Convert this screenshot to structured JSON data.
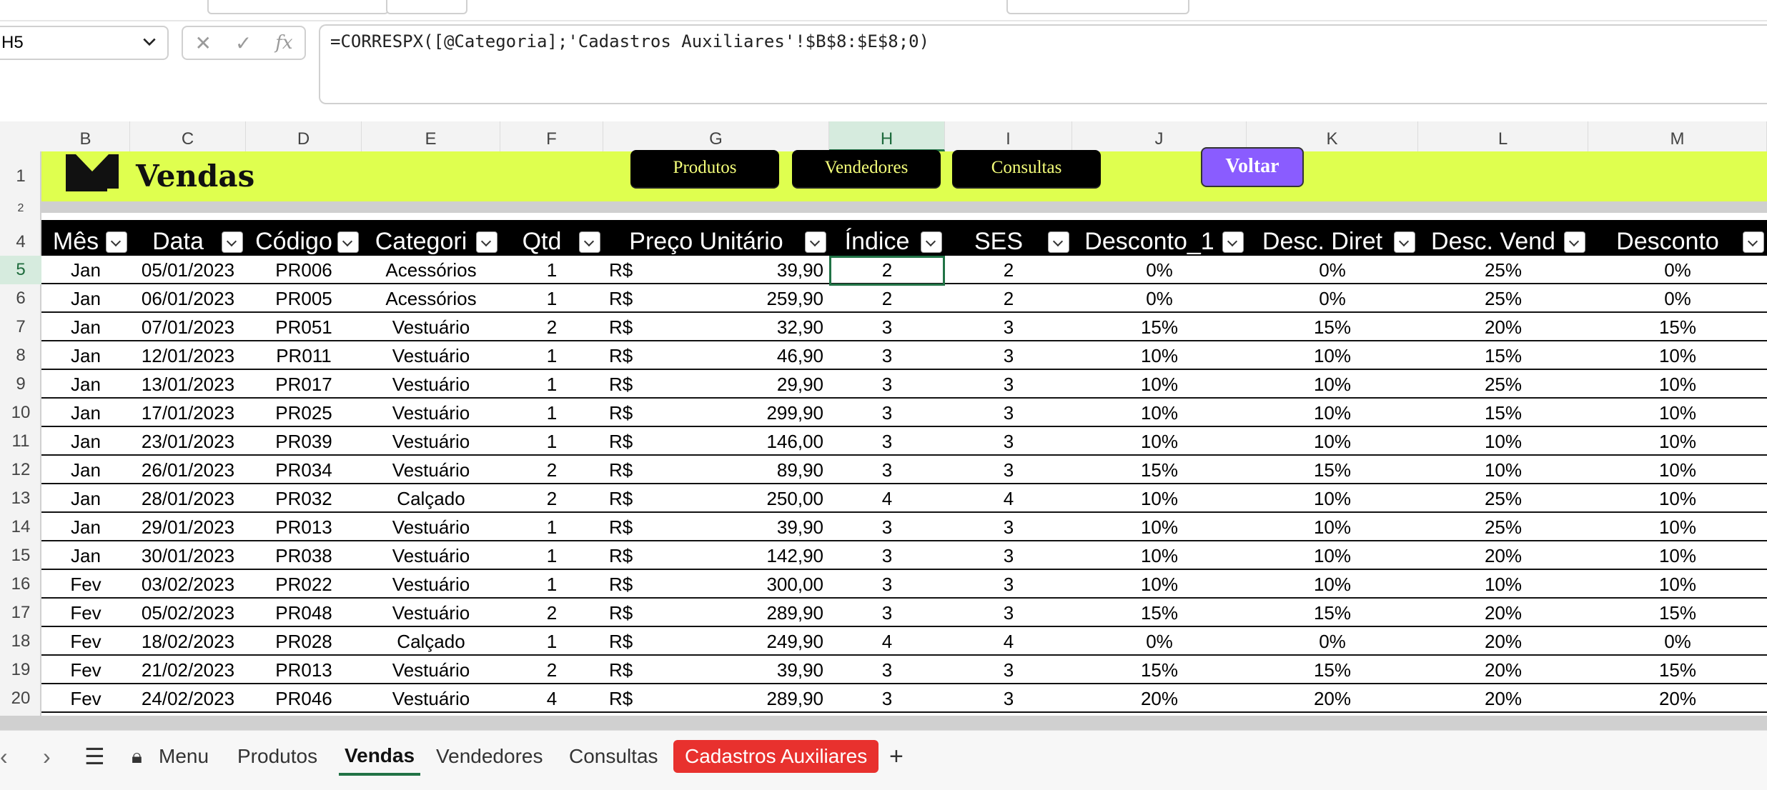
{
  "formula_bar": {
    "name_box": "H5",
    "formula": "=CORRESPX([@Categoria];'Cadastros Auxiliares'!$B$8:$E$8;0)",
    "fx_label": "fx"
  },
  "column_headers": [
    "B",
    "C",
    "D",
    "E",
    "F",
    "G",
    "H",
    "I",
    "J",
    "K",
    "L",
    "M"
  ],
  "selected_column": "H",
  "row_headers": [
    "1",
    "2",
    "4",
    "5",
    "6",
    "7",
    "8",
    "9",
    "10",
    "11",
    "12",
    "13",
    "14",
    "15",
    "16",
    "17",
    "18",
    "19",
    "20"
  ],
  "selected_row": "5",
  "banner": {
    "title": "Vendas",
    "buttons": [
      "Produtos",
      "Vendedores",
      "Consultas"
    ],
    "back_button": "Voltar"
  },
  "table": {
    "headers": [
      "Mês",
      "Data",
      "Código",
      "Categori",
      "Qtd",
      "Preço Unitário",
      "Índice",
      "SES",
      "Desconto_1",
      "Desc. Diret",
      "Desc. Vend",
      "Desconto"
    ],
    "currency_symbol": "R$",
    "rows": [
      [
        "Jan",
        "05/01/2023",
        "PR006",
        "Acessórios",
        "1",
        "39,90",
        "2",
        "2",
        "0%",
        "0%",
        "25%",
        "0%"
      ],
      [
        "Jan",
        "06/01/2023",
        "PR005",
        "Acessórios",
        "1",
        "259,90",
        "2",
        "2",
        "0%",
        "0%",
        "25%",
        "0%"
      ],
      [
        "Jan",
        "07/01/2023",
        "PR051",
        "Vestuário",
        "2",
        "32,90",
        "3",
        "3",
        "15%",
        "15%",
        "20%",
        "15%"
      ],
      [
        "Jan",
        "12/01/2023",
        "PR011",
        "Vestuário",
        "1",
        "46,90",
        "3",
        "3",
        "10%",
        "10%",
        "15%",
        "10%"
      ],
      [
        "Jan",
        "13/01/2023",
        "PR017",
        "Vestuário",
        "1",
        "29,90",
        "3",
        "3",
        "10%",
        "10%",
        "25%",
        "10%"
      ],
      [
        "Jan",
        "17/01/2023",
        "PR025",
        "Vestuário",
        "1",
        "299,90",
        "3",
        "3",
        "10%",
        "10%",
        "15%",
        "10%"
      ],
      [
        "Jan",
        "23/01/2023",
        "PR039",
        "Vestuário",
        "1",
        "146,00",
        "3",
        "3",
        "10%",
        "10%",
        "10%",
        "10%"
      ],
      [
        "Jan",
        "26/01/2023",
        "PR034",
        "Vestuário",
        "2",
        "89,90",
        "3",
        "3",
        "15%",
        "15%",
        "10%",
        "10%"
      ],
      [
        "Jan",
        "28/01/2023",
        "PR032",
        "Calçado",
        "2",
        "250,00",
        "4",
        "4",
        "10%",
        "10%",
        "25%",
        "10%"
      ],
      [
        "Jan",
        "29/01/2023",
        "PR013",
        "Vestuário",
        "1",
        "39,90",
        "3",
        "3",
        "10%",
        "10%",
        "25%",
        "10%"
      ],
      [
        "Jan",
        "30/01/2023",
        "PR038",
        "Vestuário",
        "1",
        "142,90",
        "3",
        "3",
        "10%",
        "10%",
        "20%",
        "10%"
      ],
      [
        "Fev",
        "03/02/2023",
        "PR022",
        "Vestuário",
        "1",
        "300,00",
        "3",
        "3",
        "10%",
        "10%",
        "10%",
        "10%"
      ],
      [
        "Fev",
        "05/02/2023",
        "PR048",
        "Vestuário",
        "2",
        "289,90",
        "3",
        "3",
        "15%",
        "15%",
        "20%",
        "15%"
      ],
      [
        "Fev",
        "18/02/2023",
        "PR028",
        "Calçado",
        "1",
        "249,90",
        "4",
        "4",
        "0%",
        "0%",
        "20%",
        "0%"
      ],
      [
        "Fev",
        "21/02/2023",
        "PR013",
        "Vestuário",
        "2",
        "39,90",
        "3",
        "3",
        "15%",
        "15%",
        "20%",
        "15%"
      ],
      [
        "Fev",
        "24/02/2023",
        "PR046",
        "Vestuário",
        "4",
        "289,90",
        "3",
        "3",
        "20%",
        "20%",
        "20%",
        "20%"
      ]
    ]
  },
  "sheet_tabs": {
    "tabs": [
      "Menu",
      "Produtos",
      "Vendas",
      "Vendedores",
      "Consultas",
      "Cadastros Auxiliares"
    ],
    "active": "Vendas",
    "highlighted": "Cadastros Auxiliares",
    "add_label": "+"
  },
  "colors": {
    "banner": "#dfff4f",
    "header_black": "#000000",
    "accent_green": "#217346",
    "voltar_purple": "#8a5cff",
    "tab_red": "#e8312e"
  }
}
